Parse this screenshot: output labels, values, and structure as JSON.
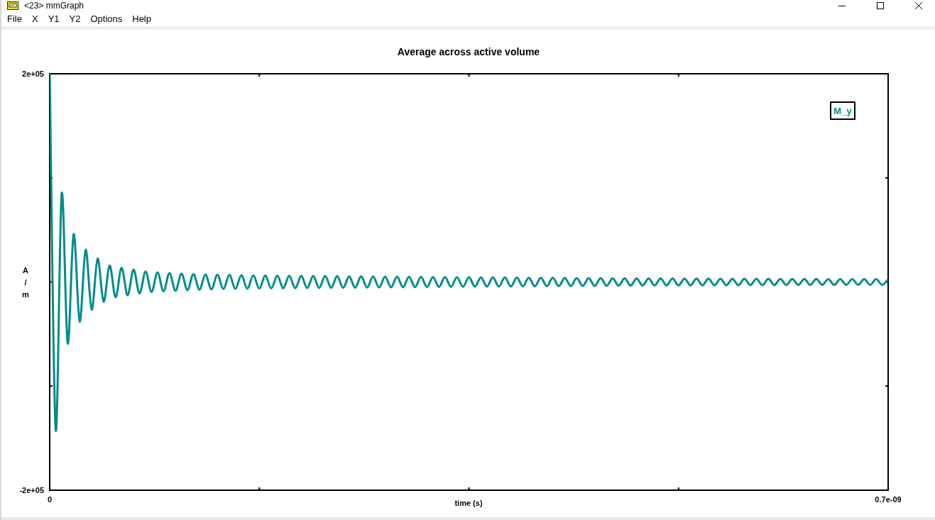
{
  "window": {
    "title": "<23> mmGraph"
  },
  "menu": [
    "File",
    "X",
    "Y1",
    "Y2",
    "Options",
    "Help"
  ],
  "graph": {
    "chart_data": {
      "type": "line",
      "title": "Average across active volume",
      "xlabel": "time (s)",
      "ylabel": "A / m",
      "x": [
        0,
        5e-12,
        1e-11,
        1.5e-11,
        2e-11,
        2.5e-11,
        3e-11,
        3.5e-11,
        4e-11,
        4.5e-11,
        5e-11,
        5.5e-11,
        6e-11,
        6.5e-11,
        7e-11,
        7.5e-11,
        8e-11,
        8.5e-11,
        9e-11,
        9.5e-11,
        1e-10,
        1.05e-10,
        1.1e-10,
        1.15e-10,
        1.2e-10,
        1.25e-10,
        1.3e-10,
        1.35e-10,
        1.4e-10,
        1.45e-10,
        1.5e-10,
        1.55e-10,
        1.6e-10,
        1.65e-10,
        1.7e-10,
        1.75e-10,
        1.8e-10,
        1.85e-10,
        1.9e-10,
        1.95e-10,
        2e-10,
        2.05e-10,
        2.1e-10,
        2.15e-10,
        2.2e-10,
        2.25e-10,
        2.3e-10,
        2.35e-10,
        2.4e-10,
        2.45e-10,
        2.5e-10,
        2.55e-10,
        2.6e-10,
        2.65e-10,
        2.7e-10,
        2.75e-10,
        2.8e-10,
        2.85e-10,
        2.9e-10,
        2.95e-10,
        3e-10,
        3.05e-10,
        3.1e-10,
        3.15e-10,
        3.2e-10,
        3.25e-10,
        3.3e-10,
        3.35e-10,
        3.4e-10,
        3.45e-10,
        3.5e-10,
        3.55e-10,
        3.6e-10,
        3.65e-10,
        3.7e-10,
        3.75e-10,
        3.8e-10,
        3.85e-10,
        3.9e-10,
        3.95e-10,
        4e-10,
        4.05e-10,
        4.1e-10,
        4.15e-10,
        4.2e-10,
        4.25e-10,
        4.3e-10,
        4.35e-10,
        4.4e-10,
        4.45e-10,
        4.5e-10,
        4.55e-10,
        4.6e-10,
        4.65e-10,
        4.7e-10,
        4.75e-10,
        4.8e-10,
        4.85e-10,
        4.9e-10,
        4.95e-10,
        5e-10,
        5.05e-10,
        5.1e-10,
        5.15e-10,
        5.2e-10,
        5.25e-10,
        5.3e-10,
        5.35e-10,
        5.4e-10,
        5.45e-10,
        5.5e-10,
        5.55e-10,
        5.6e-10,
        5.65e-10,
        5.7e-10,
        5.75e-10,
        5.8e-10,
        5.85e-10,
        5.9e-10,
        5.95e-10,
        6e-10,
        6.05e-10,
        6.1e-10,
        6.15e-10,
        6.2e-10,
        6.25e-10,
        6.3e-10,
        6.35e-10,
        6.4e-10,
        6.45e-10,
        6.5e-10,
        6.55e-10,
        6.6e-10,
        6.65e-10,
        6.7e-10,
        6.75e-10,
        6.8e-10,
        6.85e-10,
        6.9e-10,
        6.95e-10,
        7e-10
      ],
      "series": [
        {
          "name": "M_y",
          "color": "#008b8b",
          "values": [
            200000,
            -142000,
            85000,
            -59000,
            46000,
            -38000,
            31000,
            -26500,
            22500,
            -18800,
            15700,
            -14700,
            13700,
            -12800,
            11900,
            -11000,
            10000,
            -9600,
            9200,
            -8900,
            8600,
            -8300,
            8000,
            -7700,
            7500,
            -7350,
            7200,
            -7050,
            6950,
            -6850,
            6750,
            -6650,
            6550,
            -6450,
            6400,
            -6300,
            6250,
            -6150,
            6100,
            -6050,
            6000,
            -5950,
            5900,
            -5850,
            5800,
            -5750,
            5700,
            -5650,
            5600,
            -5550,
            5500,
            -5450,
            5400,
            -5350,
            5300,
            -5250,
            5200,
            -5150,
            5100,
            -5050,
            5000,
            -4950,
            4900,
            -4850,
            4810,
            -4770,
            4730,
            -4690,
            4650,
            -4610,
            4570,
            -4530,
            4490,
            -4450,
            4410,
            -4370,
            4330,
            -4290,
            4250,
            -4210,
            4170,
            -4130,
            4090,
            -4050,
            4010,
            -3970,
            3930,
            -3890,
            3850,
            -3810,
            3770,
            -3730,
            3690,
            -3650,
            3610,
            -3570,
            3530,
            -3490,
            3450,
            -3410,
            3390,
            -3370,
            3350,
            -3330,
            3310,
            -3290,
            3270,
            -3250,
            3230,
            -3210,
            3190,
            -3170,
            3150,
            -3130,
            3110,
            -3090,
            3070,
            -3050,
            3030,
            -3010,
            2990,
            -2970,
            2950,
            -2930,
            2910,
            -2890,
            2870,
            -2850,
            2830,
            -2810,
            2790,
            -2770,
            2750,
            -2730,
            2710,
            -2700,
            2700,
            -2700,
            2700,
            -2700,
            2700
          ]
        }
      ],
      "xlim": [
        0,
        7e-10
      ],
      "ylim": [
        -200000,
        200000
      ],
      "xticks": [
        {
          "value": 0,
          "label": "0"
        },
        {
          "value": 7e-10,
          "label": "0.7e-09"
        }
      ],
      "yticks": [
        {
          "value": -200000,
          "label": "-2e+05"
        },
        {
          "value": 200000,
          "label": "2e+05"
        }
      ]
    }
  }
}
